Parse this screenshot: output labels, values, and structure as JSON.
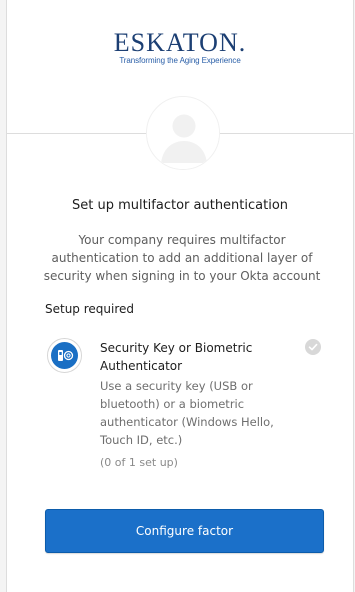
{
  "brand": {
    "logo_text": "ESKATON.",
    "tagline": "Transforming the Aging Experience"
  },
  "page": {
    "title": "Set up multifactor authentication",
    "subtitle": "Your company requires multifactor authentication to add an additional layer of security when signing in to your Okta account",
    "section_label": "Setup required"
  },
  "factor": {
    "name": "Security Key or Biometric Authenticator",
    "description": "Use a security key (USB or bluetooth) or a biometric authenticator (Windows Hello, Touch ID, etc.)",
    "status": "(0 of 1 set up)",
    "icon": "security-key-icon"
  },
  "actions": {
    "configure_label": "Configure factor"
  },
  "colors": {
    "primary_button": "#1b70c9",
    "logo_navy": "#1c3f73",
    "tagline_blue": "#2a5fa8"
  }
}
